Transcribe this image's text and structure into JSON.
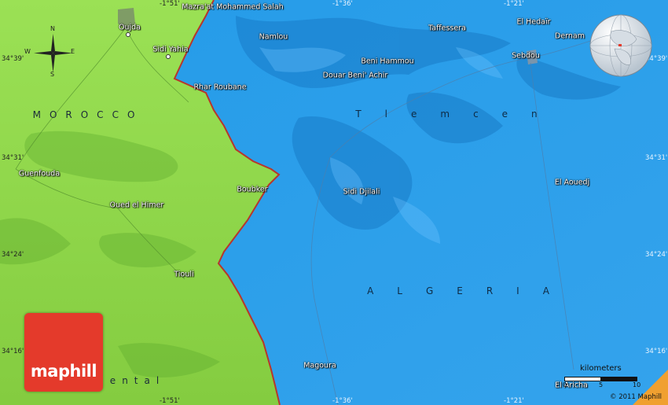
{
  "map": {
    "countries": [
      {
        "key": "morocco",
        "label": "MOROCCO"
      },
      {
        "key": "algeria",
        "label": "ALGERIA"
      }
    ],
    "region_tlemcen": "Tlemcen",
    "region_oriental_fragment": "ental",
    "places": {
      "oujda": "Oujda",
      "mazraat": "Mazra'at Mohammed Salah",
      "sidi_yahia": "Sidi Yahia",
      "namlou": "Namlou",
      "taffessera": "Taffessera",
      "el_hedair": "El Hedaïr",
      "dernam": "Dernam",
      "beni_hammou": "Beni Hammou",
      "douar_beni_achir": "Douar Beni' Achir",
      "sebdou": "Sebdou",
      "rhar_roubane": "Rhar Roubane",
      "guenfouda": "Guenfouda",
      "boubker": "Boubker",
      "sidi_djilali": "Sidi Djilali",
      "el_aouedj": "El Aouedj",
      "oued_el_himer": "Oued el Himer",
      "tiouli": "Tiouli",
      "magoura": "Magoura",
      "el_aricha": "El Aricha"
    },
    "coords": {
      "lon_top_1": "-1°51'",
      "lon_top_2": "-1°36'",
      "lon_top_3": "-1°21'",
      "lon_bottom_1": "-1°51'",
      "lon_bottom_2": "-1°36'",
      "lon_bottom_3": "-1°21'",
      "lat_left_1": "34°39'",
      "lat_left_2": "34°31'",
      "lat_left_3": "34°24'",
      "lat_left_4": "34°16'",
      "lat_right_1": "34°39'",
      "lat_right_2": "34°31'",
      "lat_right_3": "34°24'",
      "lat_right_4": "34°16'"
    },
    "compass": {
      "n": "N",
      "s": "S",
      "e": "E",
      "w": "W"
    },
    "scale": {
      "title": "kilometers",
      "ticks": [
        "0",
        "5",
        "10"
      ]
    },
    "copyright": "© 2011 Maphill",
    "logo": "maphill",
    "colors": {
      "morocco": "#8fd64a",
      "algeria": "#2f9be6",
      "border": "#b8362c",
      "logo": "#e43a2b"
    }
  }
}
